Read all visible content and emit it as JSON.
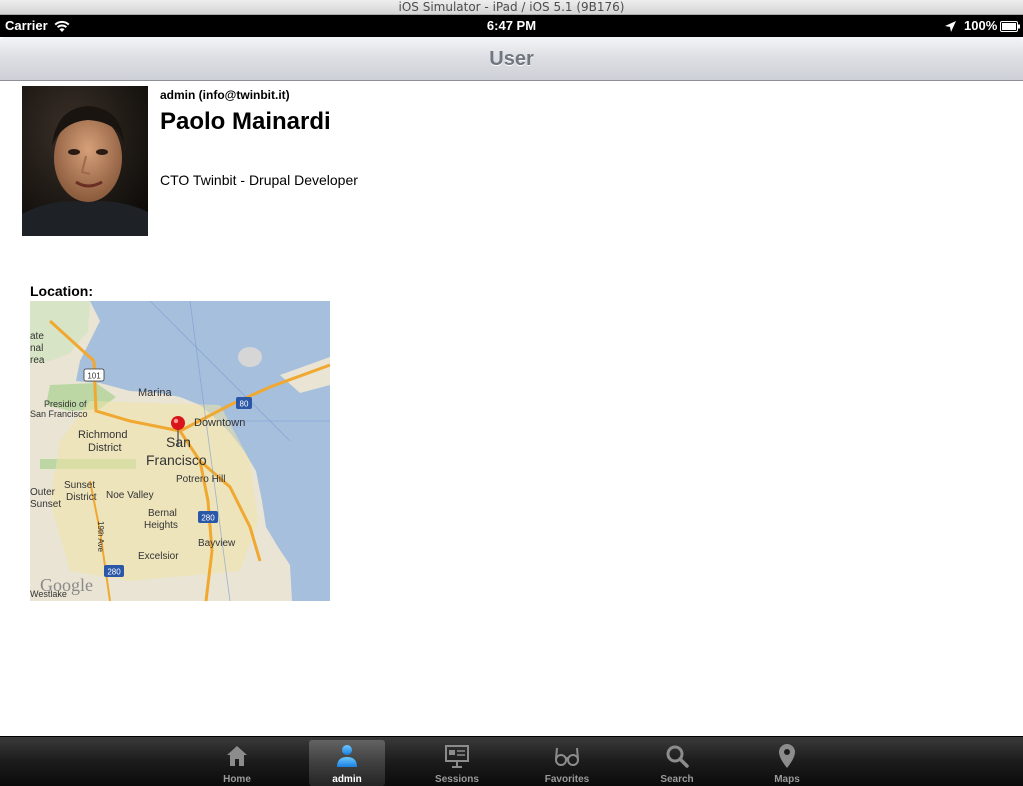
{
  "simulator": {
    "title": "iOS Simulator - iPad / iOS 5.1 (9B176)"
  },
  "status_bar": {
    "carrier": "Carrier",
    "time": "6:47 PM",
    "battery": "100%",
    "icons": [
      "wifi-icon",
      "location-arrow-icon",
      "battery-icon"
    ]
  },
  "nav": {
    "title": "User"
  },
  "profile": {
    "username": "admin (info@twinbit.it)",
    "full_name": "Paolo Mainardi",
    "role": "CTO Twinbit - Drupal Developer",
    "location_label": "Location:"
  },
  "map": {
    "labels": {
      "marina": "Marina",
      "presidio": "Presidio of",
      "san_francisco_small": "San Francisco",
      "richmond": "Richmond",
      "district": "District",
      "downtown": "Downtown",
      "san": "San",
      "francisco": "Francisco",
      "potrero": "Potrero Hill",
      "sunset": "Sunset",
      "sunset_district": "District",
      "noe": "Noe Valley",
      "outer": "Outer",
      "outer_sunset": "Sunset",
      "bernal": "Bernal",
      "heights": "Heights",
      "bayview": "Bayview",
      "excelsior": "Excelsior",
      "ave19": "19th Ave",
      "westlake": "Westlake",
      "ate": "ate",
      "nal": "nal",
      "rea": "rea",
      "hwy101": "101",
      "hwy80": "80",
      "hwy280a": "280",
      "hwy280b": "280",
      "google": "Google"
    },
    "accent_pin": "#d8151b"
  },
  "tabs": [
    {
      "label": "Home",
      "icon": "home-icon",
      "active": false
    },
    {
      "label": "admin",
      "icon": "user-icon",
      "active": true
    },
    {
      "label": "Sessions",
      "icon": "presentation-icon",
      "active": false
    },
    {
      "label": "Favorites",
      "icon": "glasses-icon",
      "active": false
    },
    {
      "label": "Search",
      "icon": "search-icon",
      "active": false
    },
    {
      "label": "Maps",
      "icon": "map-pin-icon",
      "active": false
    }
  ]
}
